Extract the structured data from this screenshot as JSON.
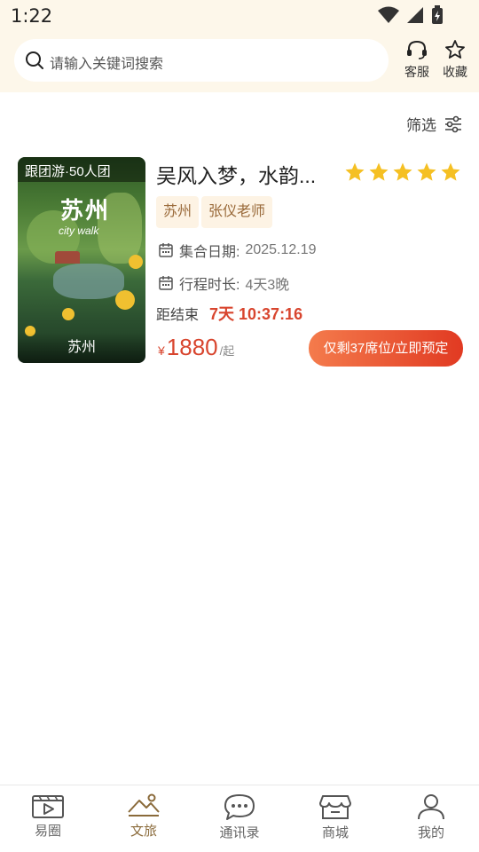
{
  "status": {
    "time": "1:22"
  },
  "header": {
    "search_placeholder": "请输入关键词搜索",
    "service_label": "客服",
    "favorite_label": "收藏"
  },
  "filter": {
    "label": "筛选"
  },
  "card": {
    "image": {
      "badge": "跟团游·50人团",
      "title": "苏州",
      "subtitle": "city walk",
      "city": "苏州"
    },
    "title": "吴风入梦，水韵...",
    "rating": 5,
    "tags": [
      "苏州",
      "张仪老师"
    ],
    "gather_label": "集合日期:",
    "gather_date": "2025.12.19",
    "duration_label": "行程时长:",
    "duration": "4天3晚",
    "countdown_label": "距结束",
    "countdown": "7天 10:37:16",
    "price_currency": "¥",
    "price": "1880",
    "price_unit": "/起",
    "book_button": "仅剩37席位/立即预定"
  },
  "tabbar": {
    "items": [
      {
        "label": "易圈",
        "icon": "video-icon",
        "active": false
      },
      {
        "label": "文旅",
        "icon": "mountain-icon",
        "active": true
      },
      {
        "label": "通讯录",
        "icon": "chat-icon",
        "active": false
      },
      {
        "label": "商城",
        "icon": "store-icon",
        "active": false
      },
      {
        "label": "我的",
        "icon": "user-icon",
        "active": false
      }
    ]
  },
  "colors": {
    "header_bg": "#fdf7ea",
    "accent_red": "#d8452e",
    "star": "#f5c023",
    "tag_bg": "#fdf3e4",
    "tag_text": "#9a6a3a"
  }
}
